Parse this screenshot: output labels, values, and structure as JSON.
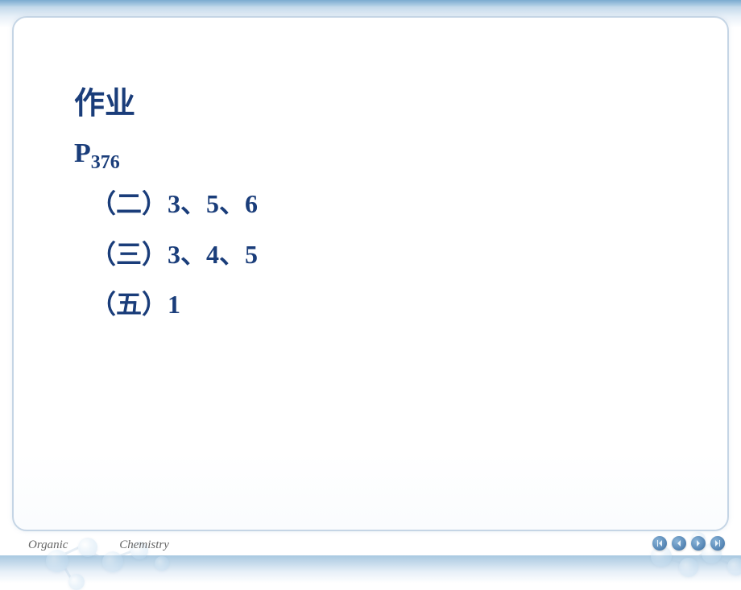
{
  "slide": {
    "title": "作业",
    "page_ref_letter": "P",
    "page_ref_number": "376",
    "assignments": [
      {
        "section": "（二）",
        "problems": "3、5、6"
      },
      {
        "section": "（三）",
        "problems": "3、4、5"
      },
      {
        "section": "（五）",
        "problems": "1"
      }
    ]
  },
  "footer": {
    "left": "Organic",
    "right": "Chemistry"
  }
}
